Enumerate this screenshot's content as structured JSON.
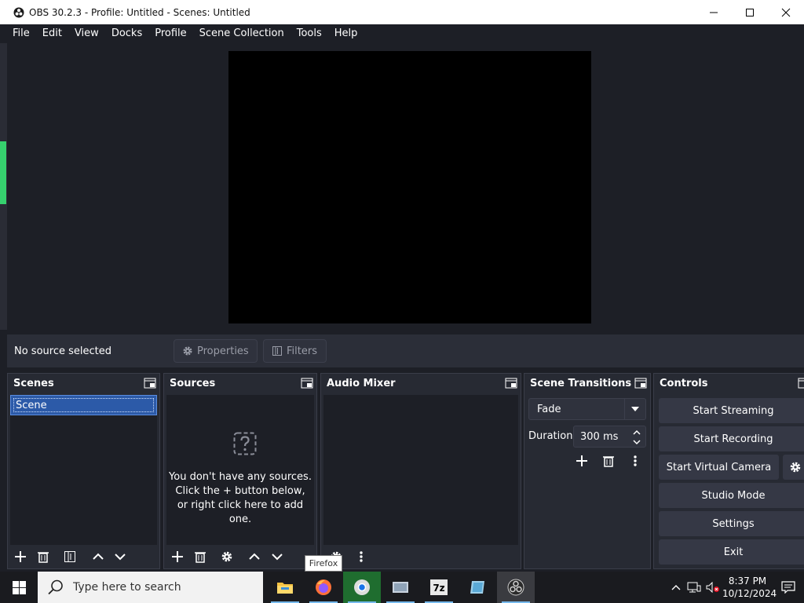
{
  "window": {
    "title": "OBS 30.2.3 - Profile: Untitled - Scenes: Untitled"
  },
  "menu": [
    "File",
    "Edit",
    "View",
    "Docks",
    "Profile",
    "Scene Collection",
    "Tools",
    "Help"
  ],
  "source_bar": {
    "status": "No source selected",
    "properties_label": "Properties",
    "filters_label": "Filters"
  },
  "scenes": {
    "title": "Scenes",
    "items": [
      "Scene"
    ]
  },
  "sources": {
    "title": "Sources",
    "empty_line1": "You don't have any sources.",
    "empty_line2": "Click the + button below,",
    "empty_line3": "or right click here to add one."
  },
  "audio_mixer": {
    "title": "Audio Mixer"
  },
  "scene_transitions": {
    "title": "Scene Transitions",
    "transition": "Fade",
    "duration_label": "Duration",
    "duration_value": "300 ms"
  },
  "controls": {
    "title": "Controls",
    "start_streaming": "Start Streaming",
    "start_recording": "Start Recording",
    "start_virtual_camera": "Start Virtual Camera",
    "studio_mode": "Studio Mode",
    "settings": "Settings",
    "exit": "Exit"
  },
  "tooltip": "Firefox",
  "taskbar": {
    "search_placeholder": "Type here to search",
    "time": "8:37 PM",
    "date": "10/12/2024",
    "apps": [
      "file-explorer",
      "firefox",
      "chrome",
      "app-4",
      "7zip",
      "app-6",
      "obs"
    ]
  },
  "colors": {
    "background": "#1d1f26",
    "panel": "#272a33",
    "button": "#353845",
    "selection": "#2c5aa8",
    "accent_green": "#36d16e"
  }
}
